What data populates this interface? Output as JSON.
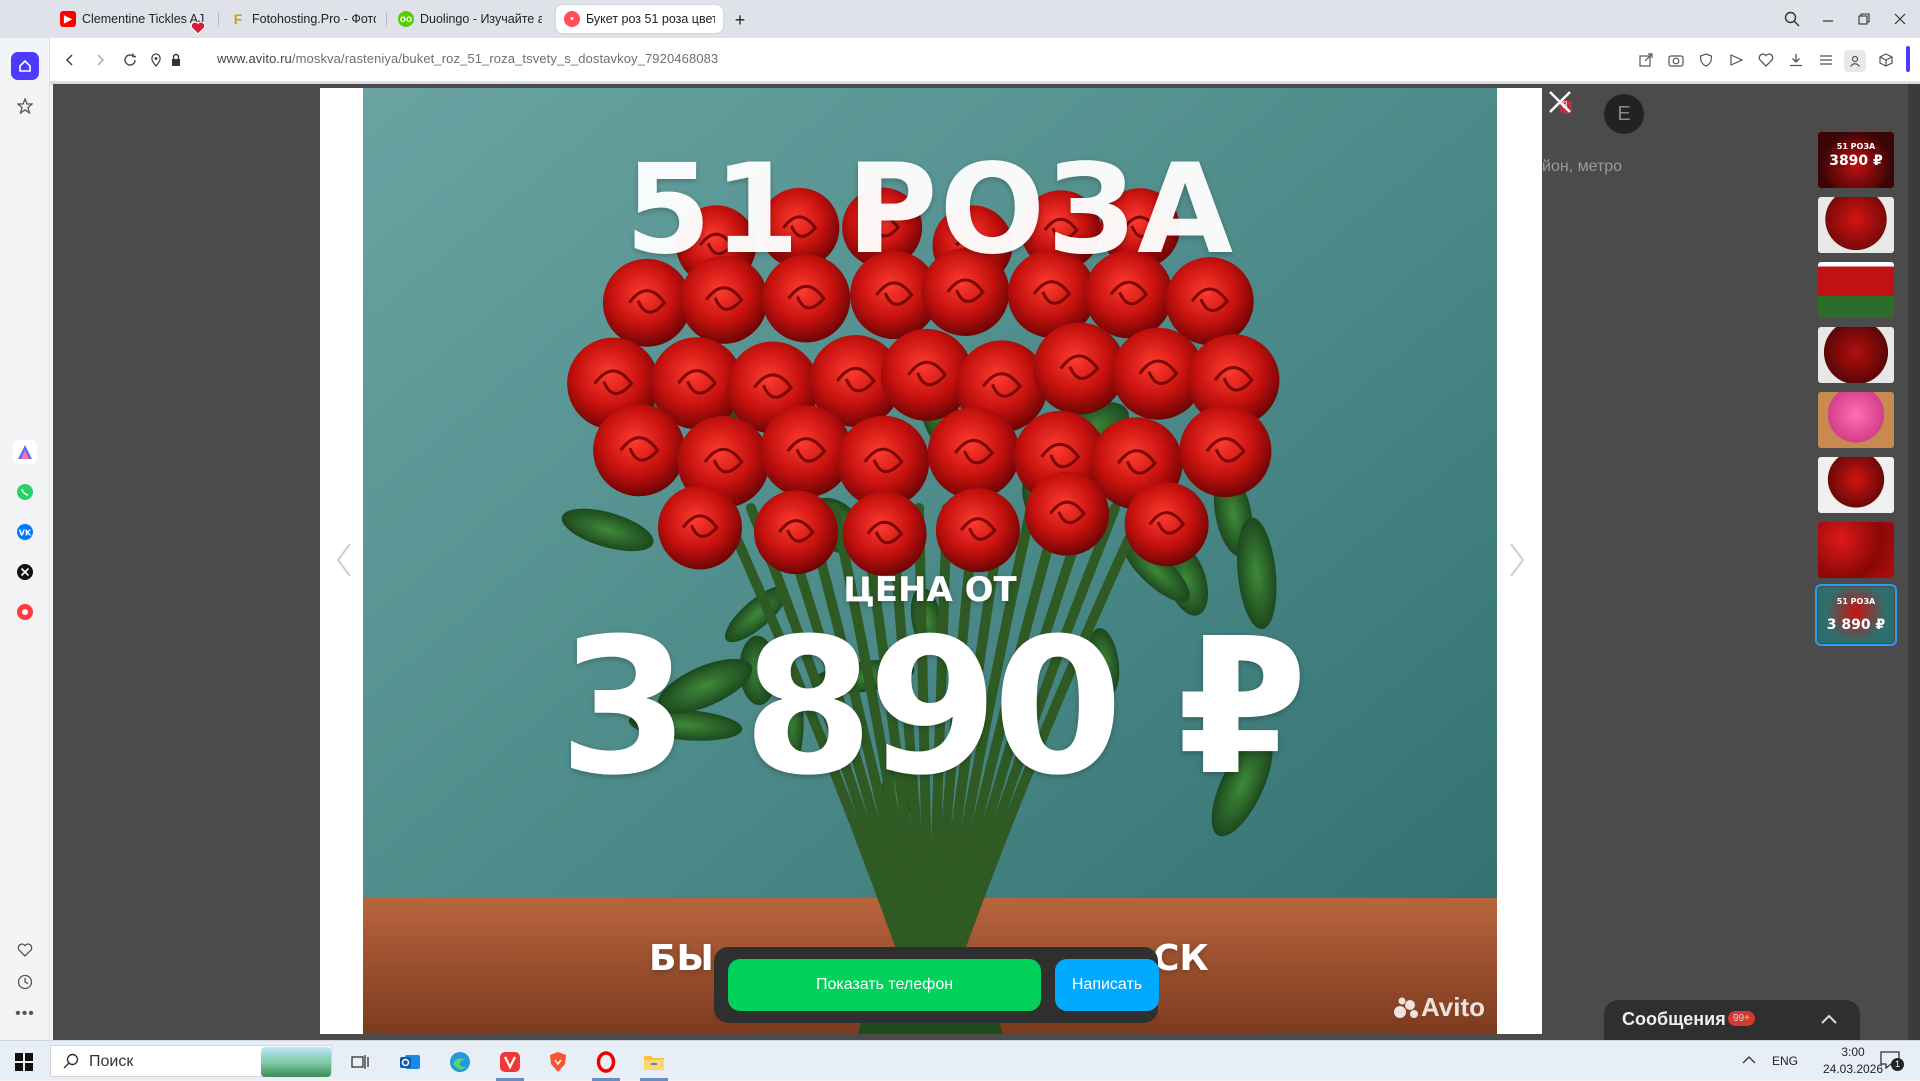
{
  "browser": {
    "tabs": [
      {
        "title": "Clementine Tickles AJ - Rc",
        "favicon": "youtube-icon"
      },
      {
        "title": "Fotohosting.Pro - Фотохо",
        "favicon": "fotohosting-icon"
      },
      {
        "title": "Duolingo - Изучайте анг",
        "favicon": "duolingo-icon"
      },
      {
        "title": "Букет роз 51 роза цветы",
        "favicon": "avito-icon",
        "active": true
      }
    ],
    "url_host": "www.avito.ru",
    "url_path": "/moskva/rasteniya/buket_roz_51_roza_tsvety_s_dostavkoy_7920468083"
  },
  "sidebar": {
    "items": [
      "home-icon",
      "star-icon",
      "aria-icon",
      "whatsapp-icon",
      "vk-icon",
      "x-icon",
      "music-icon",
      "heart-icon",
      "history-icon",
      "more-icon"
    ]
  },
  "page": {
    "header_notification_count": "8",
    "avatar_letter": "E",
    "address_hint": "йон, метро"
  },
  "photo": {
    "headline": "51 РОЗА",
    "price_caption": "ЦЕНА ОТ",
    "price": "3 890 ₽",
    "bottom_left": "БЫ",
    "bottom_right": "СК",
    "watermark": "Avito"
  },
  "thumbnails": {
    "count": 8,
    "selected_index": 7,
    "first_thumb_title": "51 РОЗА",
    "first_thumb_price": "3890 ₽",
    "last_thumb_title": "51 РОЗА",
    "last_thumb_price": "3 890 ₽"
  },
  "actions": {
    "show_phone": "Показать телефон",
    "write": "Написать"
  },
  "messages": {
    "label": "Сообщения",
    "badge": "99+"
  },
  "taskbar": {
    "search_placeholder": "Поиск",
    "language": "ENG",
    "time": "3:00",
    "date": "24.03.2026",
    "notifications": "1"
  },
  "colors": {
    "avito_green": "#02d15c",
    "avito_blue": "#00aaff",
    "overlay": "#4b4b4b",
    "photo_bg": "#4f8d8a"
  }
}
